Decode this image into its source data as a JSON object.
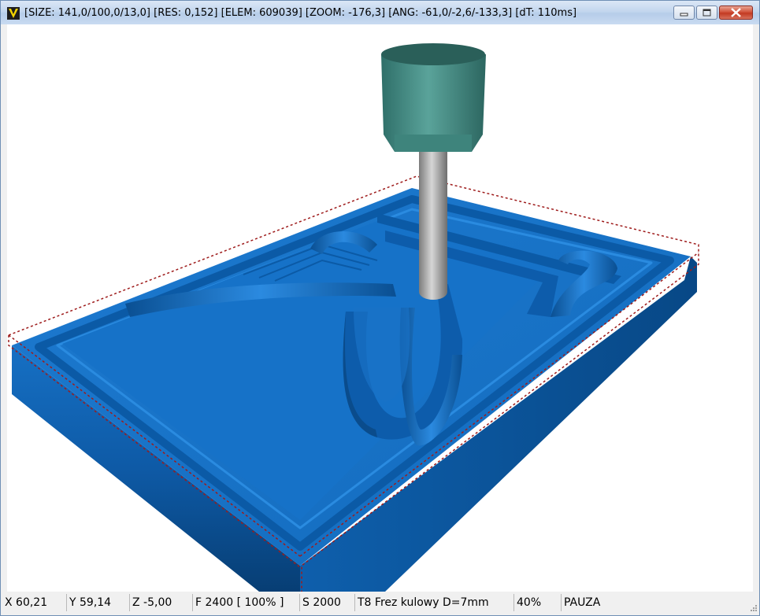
{
  "window": {
    "title": "[SIZE: 141,0/100,0/13,0] [RES: 0,152] [ELEM: 609039] [ZOOM: -176,3] [ANG: -61,0/-2,6/-133,3] [dT: 110ms]",
    "app_icon": "v-logo-icon",
    "buttons": [
      "minimize-icon",
      "maximize-icon",
      "close-icon"
    ]
  },
  "status": {
    "x": "X 60,21",
    "y": "Y 59,14",
    "z": "Z -5,00",
    "feed": "F 2400 [ 100% ]",
    "spindle": "S 2000",
    "tool": "T8 Frez kulowy D=7mm",
    "progress": "40%",
    "state": "PAUZA"
  },
  "colors": {
    "stock": "#1a6fc0",
    "stock_dark": "#0b4f93",
    "tool_holder": "#3f8a82",
    "tool_shank": "#a8a8a8",
    "bounding_box": "#9e1b1b"
  }
}
